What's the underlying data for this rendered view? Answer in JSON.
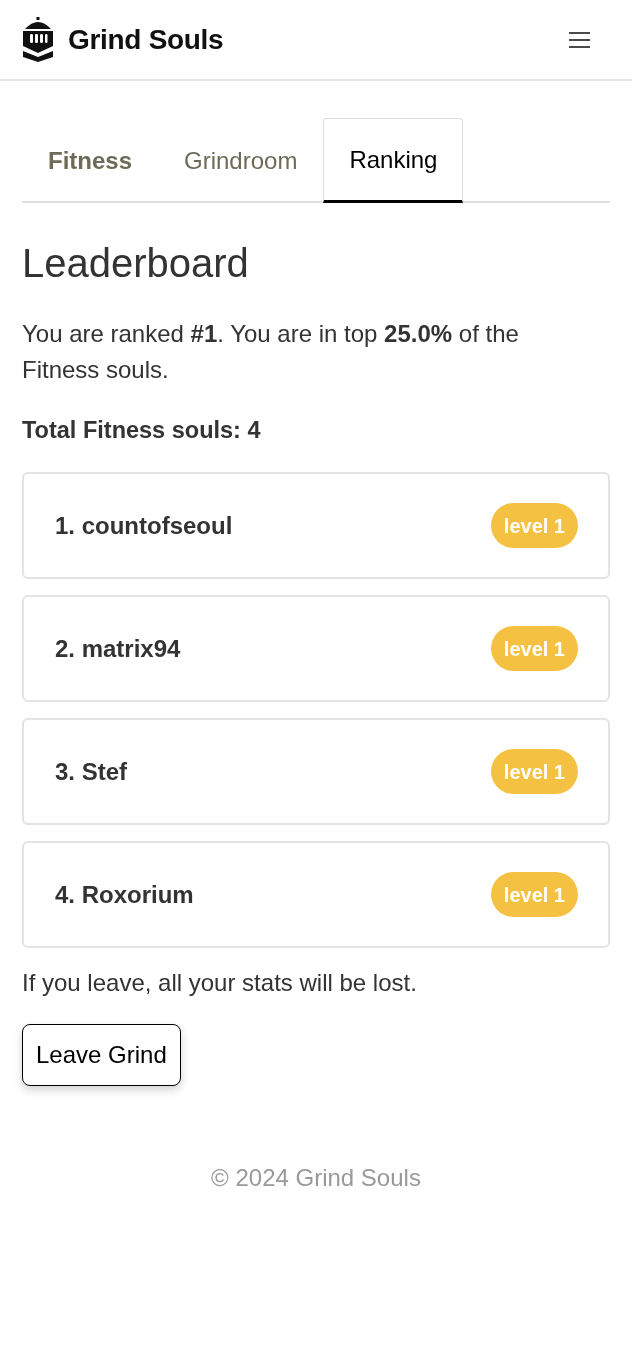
{
  "header": {
    "title": "Grind Souls"
  },
  "tabs": [
    {
      "label": "Fitness",
      "selected": false,
      "bold": true
    },
    {
      "label": "Grindroom",
      "selected": false,
      "bold": false
    },
    {
      "label": "Ranking",
      "selected": true,
      "bold": false
    }
  ],
  "leaderboard": {
    "heading": "Leaderboard",
    "summary": "You are ranked **#1**. You are in top **25.0%** of the Fitness souls.",
    "total": "Total Fitness souls: 4",
    "entries": [
      {
        "name": "1. countofseoul",
        "badge": "level 1"
      },
      {
        "name": "2. matrix94",
        "badge": "level 1"
      },
      {
        "name": "3. Stef",
        "badge": "level 1"
      },
      {
        "name": "4. Roxorium",
        "badge": "level 1"
      }
    ]
  },
  "leave": {
    "warning": "If you leave, all your stats will be lost.",
    "button": "Leave Grind"
  },
  "footer": {
    "copyright": "© 2024 Grind Souls"
  }
}
